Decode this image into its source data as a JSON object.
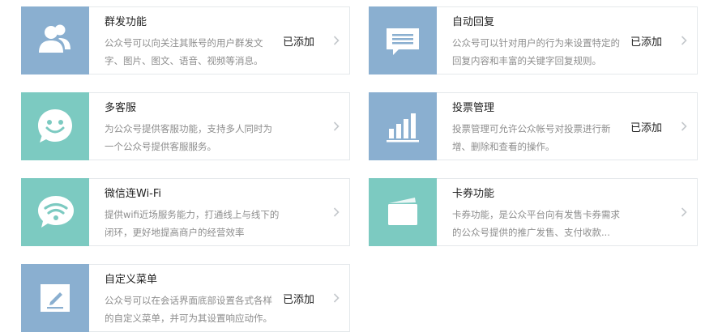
{
  "colors": {
    "blue": "#8aafd0",
    "teal": "#7ccac1",
    "border": "#e4e8eb",
    "chevron": "#c4c8cc"
  },
  "cards": [
    {
      "icon": "group-users-icon",
      "title": "群发功能",
      "desc": "公众号可以向关注其账号的用户群发文字、图片、图文、语音、视频等消息。",
      "status": "已添加"
    },
    {
      "icon": "auto-reply-message-icon",
      "title": "自动回复",
      "desc": "公众号可以针对用户的行为来设置特定的回复内容和丰富的关键字回复规则。",
      "status": "已添加"
    },
    {
      "icon": "smiley-chat-icon",
      "title": "多客服",
      "desc": "为公众号提供客服功能，支持多人同时为一个公众号提供客服服务。",
      "status": ""
    },
    {
      "icon": "bar-chart-icon",
      "title": "投票管理",
      "desc": "投票管理可允许公众帐号对投票进行新增、删除和查看的操作。",
      "status": "已添加"
    },
    {
      "icon": "wifi-chat-icon",
      "title": "微信连Wi-Fi",
      "desc": "提供wifi近场服务能力，打通线上与线下的闭环，更好地提高商户的经营效率",
      "status": ""
    },
    {
      "icon": "card-coupon-icon",
      "title": "卡券功能",
      "desc": "卡券功能，是公众平台向有发售卡券需求的公众号提供的推广发售、支付收款...",
      "status": ""
    },
    {
      "icon": "edit-menu-icon",
      "title": "自定义菜单",
      "desc": "公众号可以在会话界面底部设置各式各样的自定义菜单，并可为其设置响应动作。",
      "status": "已添加"
    }
  ]
}
